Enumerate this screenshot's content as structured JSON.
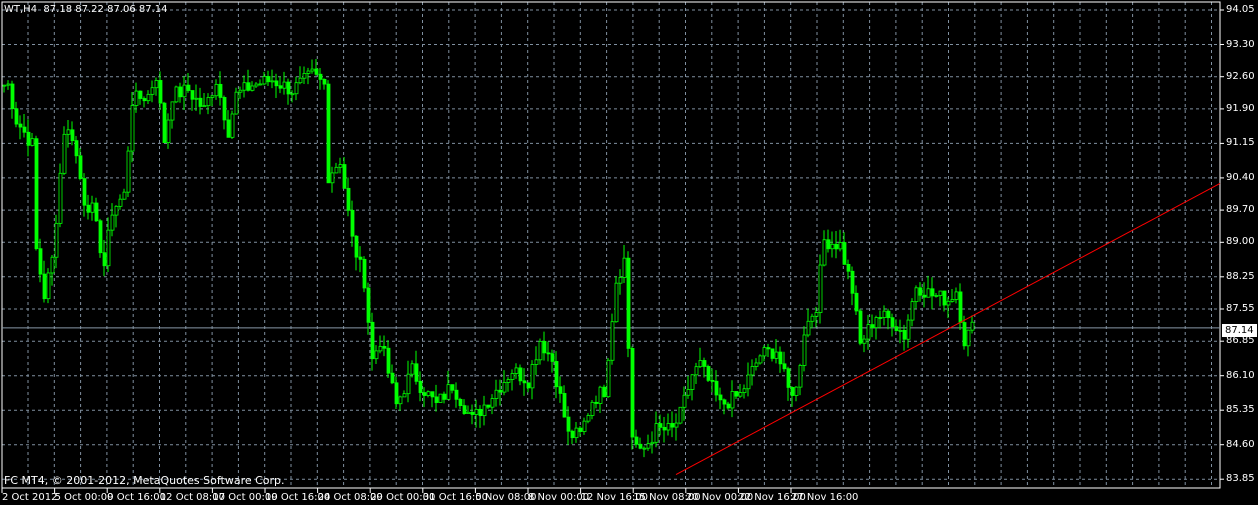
{
  "header": {
    "symbol": "WT,H4",
    "open": "87.18",
    "high": "87.22",
    "low": "87.06",
    "close": "87.14"
  },
  "footer": {
    "copyright": "FC MT4, © 2001-2012, MetaQuotes Software Corp."
  },
  "colors": {
    "background": "#000000",
    "bull": "#00ff00",
    "bear": "#00ff00",
    "grid": "#8090a0",
    "trendline": "#ff0000",
    "axis": "#ffffff"
  },
  "chart_data": {
    "type": "candlestick",
    "title": "WT,H4",
    "current_price": "87.14",
    "ylim": [
      83.85,
      94.05
    ],
    "y_ticks": [
      "94.05",
      "93.30",
      "92.60",
      "91.90",
      "91.15",
      "90.40",
      "89.70",
      "89.00",
      "88.25",
      "87.55",
      "86.85",
      "86.10",
      "85.35",
      "84.60",
      "83.85"
    ],
    "x_ticks": [
      "2 Oct 2012",
      "5 Oct 00:00",
      "9 Oct 16:00",
      "12 Oct 08:00",
      "17 Oct 00:00",
      "19 Oct 16:00",
      "24 Oct 08:00",
      "29 Oct 00:00",
      "31 Oct 16:00",
      "5 Nov 08:00",
      "8 Nov 00:00",
      "12 Nov 16:00",
      "15 Nov 08:00",
      "20 Nov 00:00",
      "22 Nov 16:00",
      "27 Nov 16:00"
    ],
    "close_anchors_bar_price": [
      [
        1,
        92.42
      ],
      [
        3,
        91.66
      ],
      [
        7,
        91.12
      ],
      [
        8,
        88.83
      ],
      [
        10,
        87.85
      ],
      [
        12,
        88.62
      ],
      [
        15,
        91.44
      ],
      [
        17,
        91.33
      ],
      [
        20,
        89.92
      ],
      [
        22,
        89.7
      ],
      [
        25,
        88.51
      ],
      [
        27,
        89.7
      ],
      [
        30,
        90.03
      ],
      [
        32,
        92.09
      ],
      [
        36,
        92.2
      ],
      [
        38,
        92.64
      ],
      [
        40,
        91.22
      ],
      [
        42,
        92.2
      ],
      [
        46,
        92.31
      ],
      [
        50,
        91.88
      ],
      [
        53,
        92.53
      ],
      [
        56,
        91.44
      ],
      [
        58,
        92.2
      ],
      [
        62,
        92.42
      ],
      [
        67,
        92.53
      ],
      [
        72,
        92.31
      ],
      [
        77,
        92.64
      ],
      [
        80,
        92.42
      ],
      [
        81,
        90.46
      ],
      [
        84,
        90.79
      ],
      [
        87,
        89.05
      ],
      [
        90,
        88.18
      ],
      [
        92,
        86.44
      ],
      [
        94,
        86.88
      ],
      [
        98,
        85.46
      ],
      [
        102,
        86.22
      ],
      [
        104,
        85.9
      ],
      [
        108,
        85.46
      ],
      [
        112,
        85.9
      ],
      [
        117,
        85.14
      ],
      [
        122,
        85.68
      ],
      [
        127,
        86.22
      ],
      [
        131,
        86.01
      ],
      [
        134,
        86.88
      ],
      [
        137,
        86.44
      ],
      [
        141,
        84.81
      ],
      [
        144,
        84.81
      ],
      [
        147,
        85.57
      ],
      [
        150,
        85.79
      ],
      [
        153,
        88.18
      ],
      [
        155,
        88.62
      ],
      [
        157,
        84.81
      ],
      [
        159,
        84.38
      ],
      [
        163,
        84.92
      ],
      [
        167,
        84.92
      ],
      [
        169,
        85.25
      ],
      [
        172,
        86.12
      ],
      [
        174,
        86.33
      ],
      [
        179,
        85.46
      ],
      [
        184,
        85.68
      ],
      [
        189,
        86.55
      ],
      [
        193,
        86.66
      ],
      [
        196,
        85.79
      ],
      [
        198,
        85.79
      ],
      [
        200,
        87.09
      ],
      [
        203,
        87.64
      ],
      [
        205,
        89.05
      ],
      [
        209,
        88.94
      ],
      [
        212,
        87.96
      ],
      [
        214,
        86.77
      ],
      [
        218,
        87.42
      ],
      [
        222,
        87.31
      ],
      [
        225,
        86.98
      ],
      [
        228,
        88.07
      ],
      [
        232,
        87.85
      ],
      [
        236,
        87.75
      ],
      [
        238,
        87.96
      ],
      [
        240,
        86.88
      ],
      [
        242,
        87.14
      ]
    ],
    "trendline": {
      "from_bar_price": [
        168,
        83.95
      ],
      "to_bar_price": [
        304,
        90.28
      ]
    }
  }
}
